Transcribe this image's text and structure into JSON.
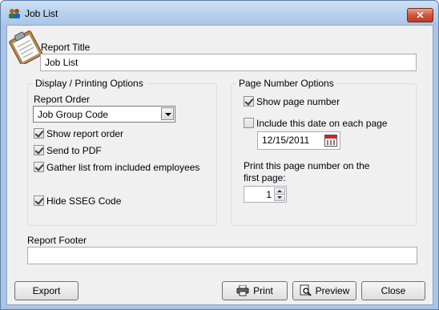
{
  "window": {
    "title": "Job List",
    "close_label": "✕"
  },
  "report_title": {
    "label": "Report Title",
    "value": "Job List"
  },
  "display_options": {
    "group_label": "Display / Printing Options",
    "report_order_label": "Report Order",
    "report_order_value": "Job Group Code",
    "show_report_order": {
      "label": "Show report order",
      "checked": true
    },
    "send_to_pdf": {
      "label": "Send to PDF",
      "checked": true
    },
    "gather_list": {
      "label": "Gather list from included employees",
      "checked": true
    },
    "hide_sseg": {
      "label": "Hide SSEG Code",
      "checked": true
    }
  },
  "page_number_options": {
    "group_label": "Page Number Options",
    "show_page_number": {
      "label": "Show page number",
      "checked": true
    },
    "include_date": {
      "label": "Include this date on each page",
      "checked": false
    },
    "date_value": "12/15/2011",
    "first_page_label_line1": "Print this page number on the",
    "first_page_label_line2": "first page:",
    "first_page_value": "1"
  },
  "report_footer": {
    "label": "Report Footer",
    "value": ""
  },
  "buttons": {
    "export": "Export",
    "print": "Print",
    "preview": "Preview",
    "close": "Close"
  },
  "icons": {
    "app": "users-icon",
    "clipboard": "clipboard-icon",
    "calendar": "calendar-icon",
    "printer": "printer-icon",
    "preview": "magnifier-icon"
  }
}
